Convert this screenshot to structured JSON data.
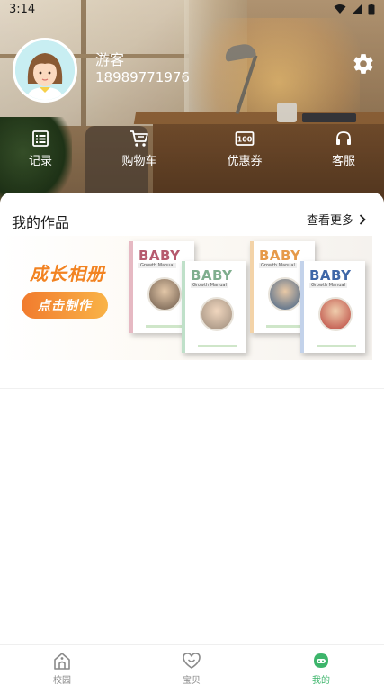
{
  "status_bar": {
    "time": "3:14"
  },
  "profile": {
    "name": "游客",
    "phone": "18989771976"
  },
  "quick_menu": [
    {
      "label": "记录",
      "icon": "list-icon"
    },
    {
      "label": "购物车",
      "icon": "cart-icon"
    },
    {
      "label": "优惠券",
      "icon": "coupon-icon"
    },
    {
      "label": "客服",
      "icon": "headset-icon"
    }
  ],
  "works": {
    "title": "我的作品",
    "more": "查看更多",
    "banner": {
      "title": "成长相册",
      "cta": "点击制作",
      "books": [
        {
          "title": "BABY",
          "subtitle": "Growth Manual",
          "color": "#b65a6e"
        },
        {
          "title": "BABY",
          "subtitle": "Growth Manual",
          "color": "#7fae8e"
        },
        {
          "title": "BABY",
          "subtitle": "Growth Manual",
          "color": "#e69a4a"
        },
        {
          "title": "BABY",
          "subtitle": "Growth Manual",
          "color": "#3f67a8"
        }
      ]
    }
  },
  "tabs": [
    {
      "label": "校园",
      "icon": "school-icon",
      "active": false
    },
    {
      "label": "宝贝",
      "icon": "heart-icon",
      "active": false
    },
    {
      "label": "我的",
      "icon": "profile-icon",
      "active": true
    }
  ],
  "colors": {
    "accent": "#3db56b",
    "banner_orange": "#f28322"
  }
}
